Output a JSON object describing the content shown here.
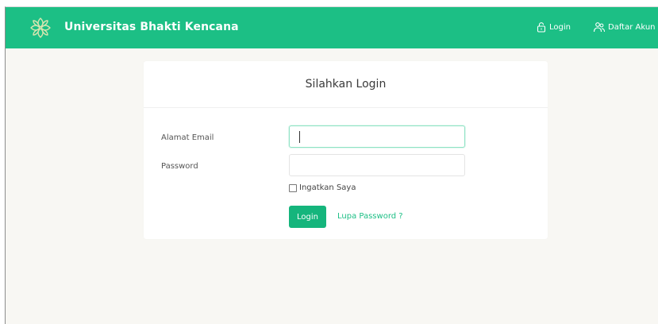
{
  "navbar": {
    "brand": "Universitas Bhakti Kencana",
    "login_label": "Login",
    "register_label": "Daftar Akun",
    "logo_icon": "flower-logo",
    "login_icon": "lock-icon",
    "register_icon": "users-icon"
  },
  "login_card": {
    "title": "Silahkan Login",
    "email_label": "Alamat Email",
    "email_value": "",
    "password_label": "Password",
    "password_value": "",
    "remember_label": "Ingatkan Saya",
    "remember_checked": false,
    "submit_label": "Login",
    "forgot_label": "Lupa Password ?"
  },
  "colors": {
    "primary": "#1cbf85",
    "button": "#15b57c",
    "background": "#f8f7f3",
    "logo": "#d8e5b0"
  }
}
